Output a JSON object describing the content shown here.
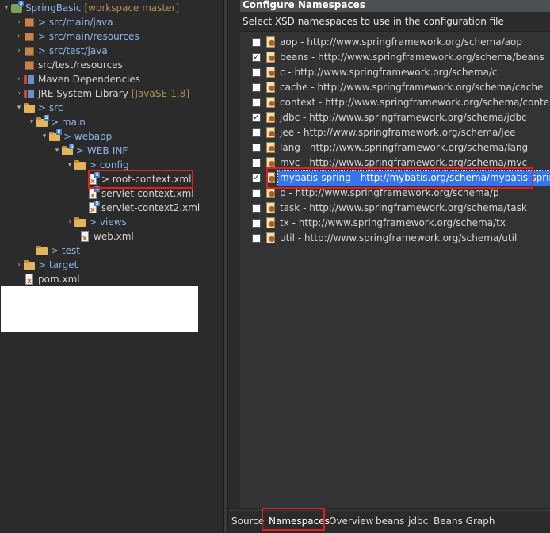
{
  "explorer": {
    "project": {
      "name": "SpringBasic",
      "decoration": "[workspace master]"
    },
    "items": [
      {
        "label": "src/main/java",
        "arrow": ">"
      },
      {
        "label": "src/main/resources",
        "arrow": ">"
      },
      {
        "label": "src/test/java",
        "arrow": ">"
      },
      {
        "label": "src/test/resources"
      },
      {
        "label": "Maven Dependencies"
      },
      {
        "label": "JRE System Library",
        "decoration": "[JavaSE-1.8]"
      },
      {
        "label": "src",
        "arrow": ">"
      },
      {
        "label": "main",
        "arrow": ">"
      },
      {
        "label": "webapp",
        "arrow": ">"
      },
      {
        "label": "WEB-INF",
        "arrow": ">"
      },
      {
        "label": "config",
        "arrow": ">"
      },
      {
        "label": "root-context.xml",
        "arrow": ">"
      },
      {
        "label": "servlet-context.xml"
      },
      {
        "label": "servlet-context2.xml"
      },
      {
        "label": "views",
        "arrow": ">"
      },
      {
        "label": "web.xml"
      },
      {
        "label": "test",
        "arrow": ">"
      },
      {
        "label": "target",
        "arrow": ">"
      },
      {
        "label": "pom.xml"
      }
    ]
  },
  "editor": {
    "section_title": "Configure Namespaces",
    "description": "Select XSD namespaces to use in the configuration file",
    "namespaces": [
      {
        "label": "aop - http://www.springframework.org/schema/aop",
        "checked": false
      },
      {
        "label": "beans - http://www.springframework.org/schema/beans",
        "checked": true
      },
      {
        "label": "c - http://www.springframework.org/schema/c",
        "checked": false
      },
      {
        "label": "cache - http://www.springframework.org/schema/cache",
        "checked": false
      },
      {
        "label": "context - http://www.springframework.org/schema/context",
        "checked": false
      },
      {
        "label": "jdbc - http://www.springframework.org/schema/jdbc",
        "checked": true
      },
      {
        "label": "jee - http://www.springframework.org/schema/jee",
        "checked": false
      },
      {
        "label": "lang - http://www.springframework.org/schema/lang",
        "checked": false
      },
      {
        "label": "mvc - http://www.springframework.org/schema/mvc",
        "checked": false
      },
      {
        "label": "mybatis-spring - http://mybatis.org/schema/mybatis-spring",
        "checked": true,
        "selected": true
      },
      {
        "label": "p - http://www.springframework.org/schema/p",
        "checked": false
      },
      {
        "label": "task - http://www.springframework.org/schema/task",
        "checked": false
      },
      {
        "label": "tx - http://www.springframework.org/schema/tx",
        "checked": false
      },
      {
        "label": "util - http://www.springframework.org/schema/util",
        "checked": false
      }
    ],
    "tabs": [
      "Source",
      "Namespaces",
      "Overview",
      "beans",
      "jdbc",
      "Beans Graph"
    ],
    "active_tab": "Namespaces"
  },
  "colors": {
    "highlight_box": "#e02020",
    "selection": "#3574f0"
  }
}
